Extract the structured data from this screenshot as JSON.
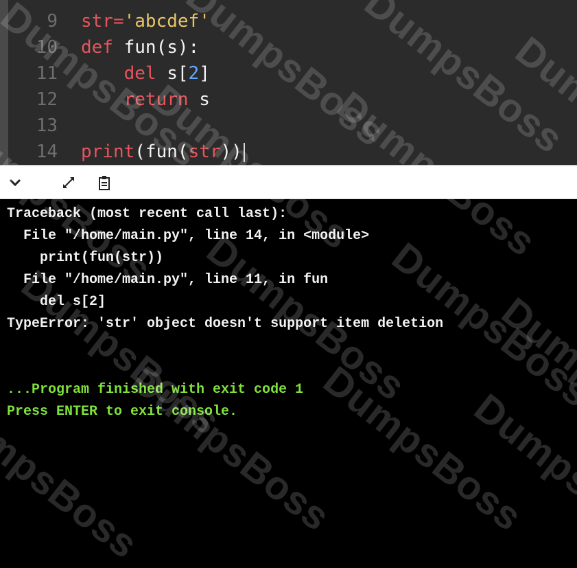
{
  "editor": {
    "lines": [
      {
        "num": "9",
        "tokens": [
          {
            "t": "str",
            "c": "kw"
          },
          {
            "t": "=",
            "c": "op"
          },
          {
            "t": "'abcdef'",
            "c": "str"
          }
        ]
      },
      {
        "num": "10",
        "tokens": [
          {
            "t": "def ",
            "c": "kw"
          },
          {
            "t": "fun(s):",
            "c": "fn"
          }
        ]
      },
      {
        "num": "11",
        "tokens": [
          {
            "t": "    del ",
            "c": "kw"
          },
          {
            "t": "s[",
            "c": "fn"
          },
          {
            "t": "2",
            "c": "num"
          },
          {
            "t": "]",
            "c": "fn"
          }
        ]
      },
      {
        "num": "12",
        "tokens": [
          {
            "t": "    return ",
            "c": "kw"
          },
          {
            "t": "s",
            "c": "fn"
          }
        ]
      },
      {
        "num": "13",
        "tokens": []
      },
      {
        "num": "14",
        "tokens": [
          {
            "t": "print",
            "c": "kw"
          },
          {
            "t": "(fun(",
            "c": "fn"
          },
          {
            "t": "str",
            "c": "kw"
          },
          {
            "t": "))",
            "c": "fn"
          }
        ]
      }
    ]
  },
  "toolbar": {
    "buttons": [
      {
        "name": "collapse-console-button",
        "icon": "chevron-down-icon"
      },
      {
        "name": "expand-console-button",
        "icon": "expand-arrows-icon"
      },
      {
        "name": "copy-output-button",
        "icon": "clipboard-icon"
      }
    ]
  },
  "console": {
    "lines": [
      {
        "text": "Traceback (most recent call last):",
        "color": "#f2f2f2"
      },
      {
        "text": "  File \"/home/main.py\", line 14, in <module>",
        "color": "#f2f2f2"
      },
      {
        "text": "    print(fun(str))",
        "color": "#f2f2f2"
      },
      {
        "text": "  File \"/home/main.py\", line 11, in fun",
        "color": "#f2f2f2"
      },
      {
        "text": "    del s[2]",
        "color": "#f2f2f2"
      },
      {
        "text": "TypeError: 'str' object doesn't support item deletion",
        "color": "#f2f2f2"
      },
      {
        "text": "",
        "color": "#f2f2f2"
      },
      {
        "text": "",
        "color": "#f2f2f2"
      },
      {
        "text": "...Program finished with exit code 1",
        "color": "#7fe23b"
      },
      {
        "text": "Press ENTER to exit console.",
        "color": "#7fe23b"
      }
    ]
  },
  "watermark": {
    "text": "DumpsBoss"
  }
}
